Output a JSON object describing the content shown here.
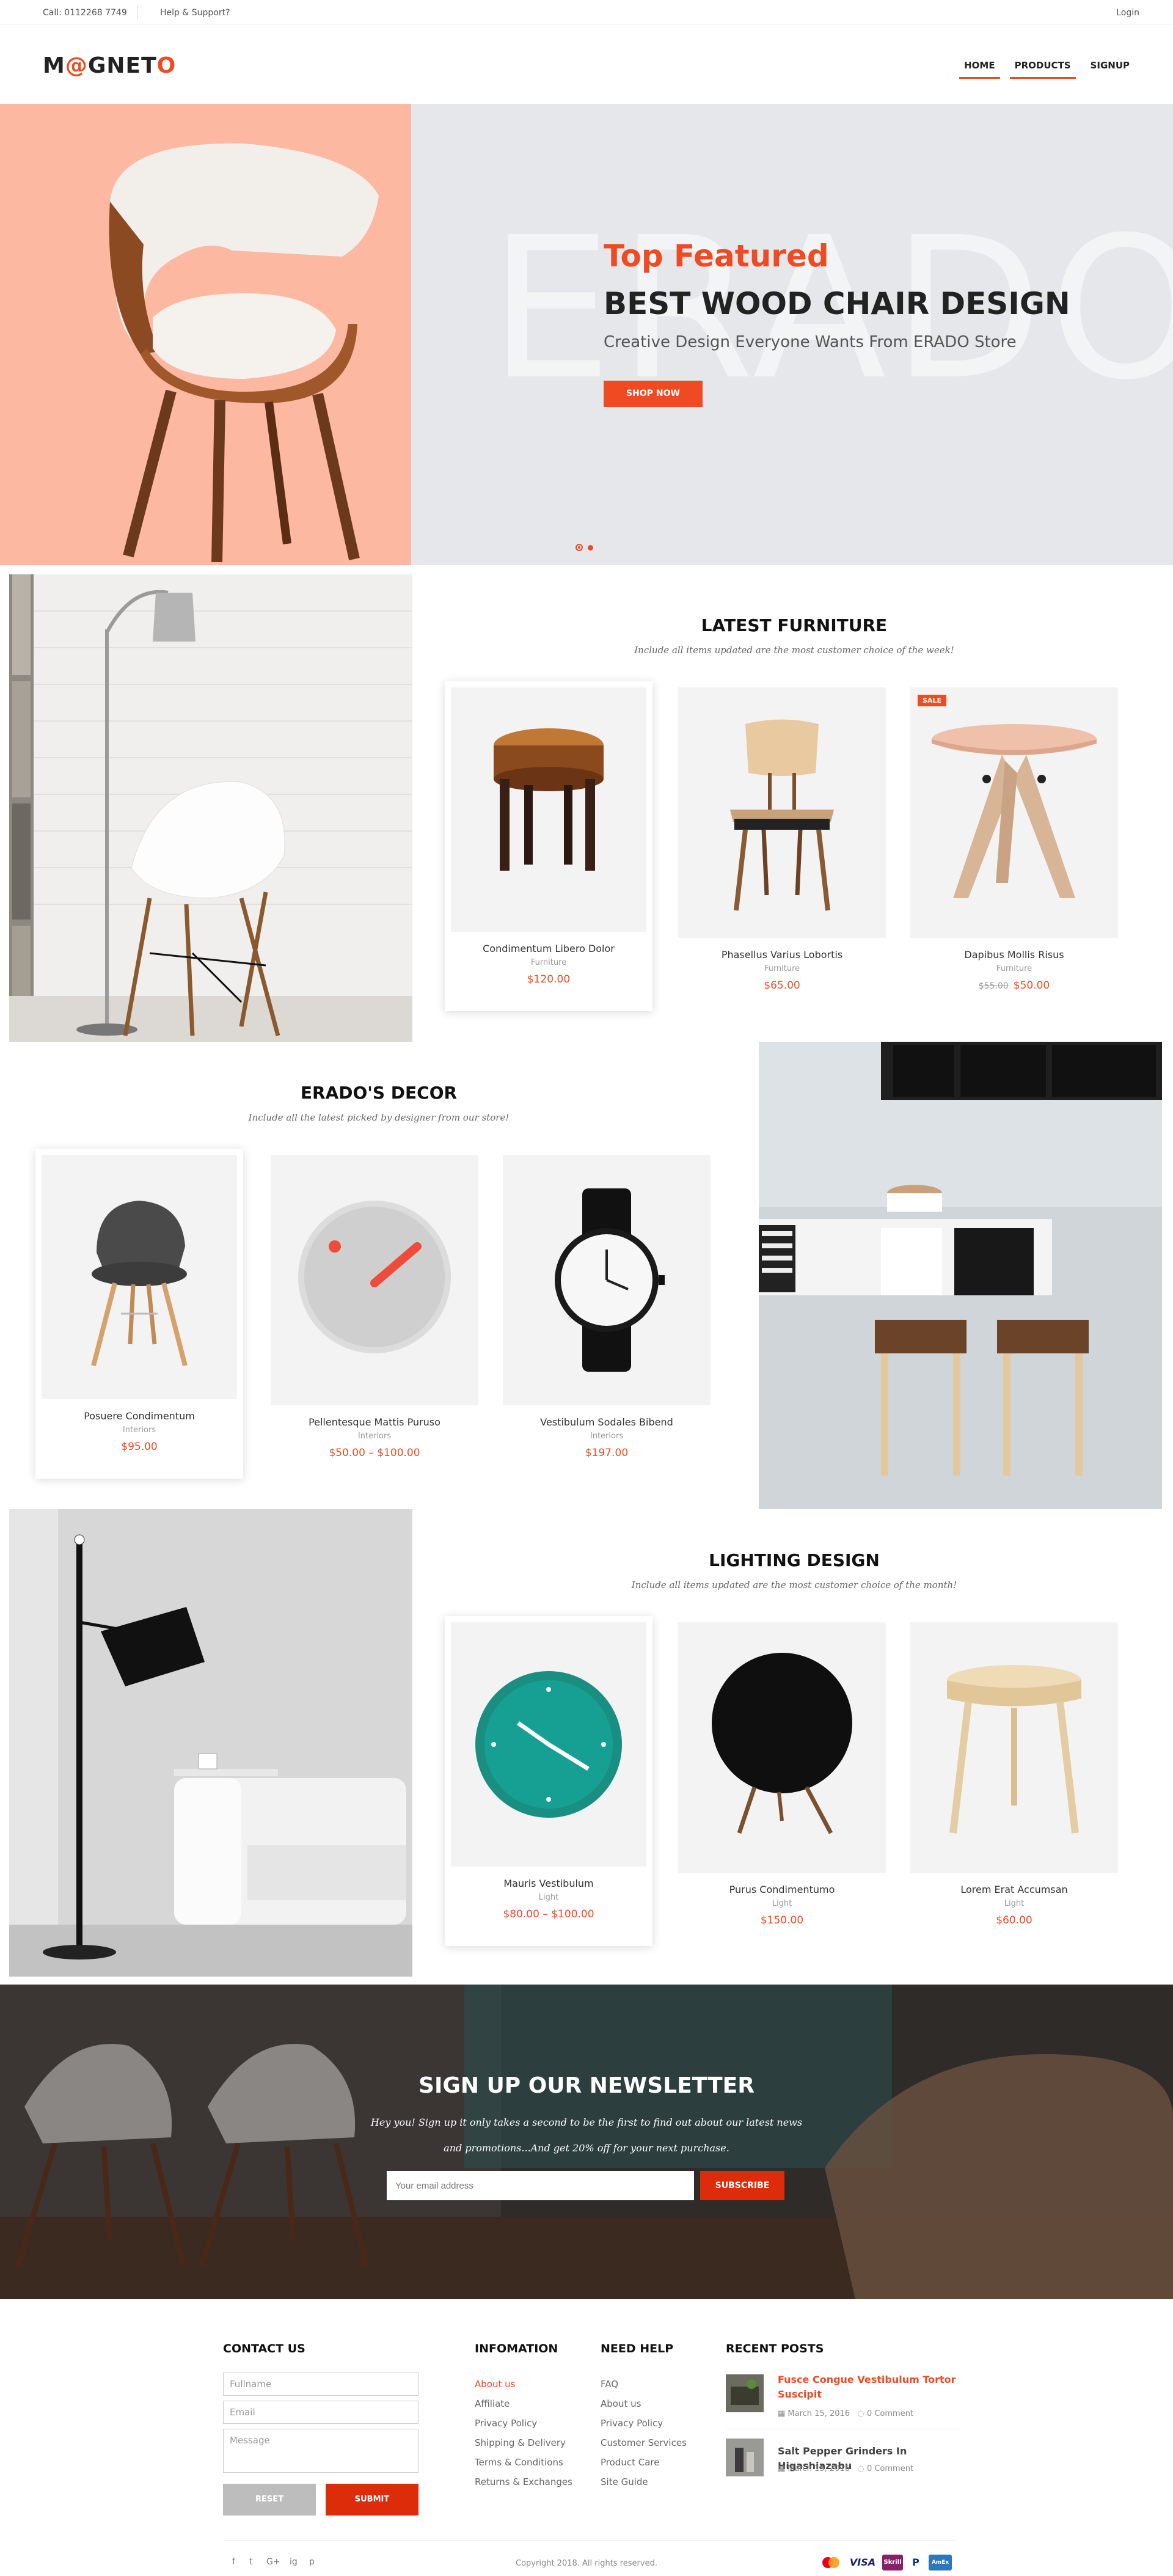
{
  "topbar": {
    "call": "Call: 0112268 7749",
    "help": "Help & Support?",
    "login": "Login"
  },
  "header": {
    "logo_pre": "M",
    "logo_at": "@",
    "logo_mid": "GNET",
    "logo_o": "O",
    "nav": [
      "HOME",
      "PRODUCTS",
      "SIGNUP"
    ]
  },
  "hero": {
    "bigword": "ERADO",
    "top": "Top Featured",
    "title": "BEST WOOD CHAIR DESIGN",
    "subtitle": "Creative Design Everyone Wants From ERADO Store",
    "button": "SHOP NOW"
  },
  "latest": {
    "title": "LATEST FURNITURE",
    "subtitle": "Include all items updated are the most customer choice of the week!",
    "products": [
      {
        "name": "Condimentum Libero Dolor",
        "category": "Furniture",
        "price": "$120.00"
      },
      {
        "name": "Phasellus Varius Lobortis",
        "category": "Furniture",
        "price": "$65.00"
      },
      {
        "name": "Dapibus Mollis Risus",
        "category": "Furniture",
        "old_price": "$55.00",
        "price": "$50.00",
        "badge": "SALE"
      }
    ]
  },
  "decor": {
    "title": "ERADO'S DECOR",
    "subtitle": "Include all the latest picked by designer from our store!",
    "products": [
      {
        "name": "Posuere Condimentum",
        "category": "Interiors",
        "price": "$95.00"
      },
      {
        "name": "Pellentesque Mattis Puruso",
        "category": "Interiors",
        "price": "$50.00 – $100.00"
      },
      {
        "name": "Vestibulum Sodales Bibend",
        "category": "Interiors",
        "price": "$197.00"
      }
    ]
  },
  "lighting": {
    "title": "LIGHTING DESIGN",
    "subtitle": "Include all items updated are the most customer choice of the month!",
    "products": [
      {
        "name": "Mauris Vestibulum",
        "category": "Light",
        "price": "$80.00 – $100.00"
      },
      {
        "name": "Purus Condimentumo",
        "category": "Light",
        "price": "$150.00"
      },
      {
        "name": "Lorem Erat Accumsan",
        "category": "Light",
        "price": "$60.00"
      }
    ]
  },
  "newsletter": {
    "title": "SIGN UP OUR NEWSLETTER",
    "line1": "Hey you! Sign up it only takes a second to be the first to find out about our latest news",
    "line2": "and promotions...And get 20% off for your next purchase.",
    "placeholder": "Your email address",
    "button": "SUBSCRIBE"
  },
  "footer": {
    "contact": {
      "title": "CONTACT US",
      "fullname": "Fullname",
      "email": "Email",
      "message": "Message",
      "reset": "RESET",
      "submit": "SUBMIT"
    },
    "info": {
      "title": "INFOMATION",
      "links": [
        "About us",
        "Affiliate",
        "Privacy Policy",
        "Shipping & Delivery",
        "Terms & Conditions",
        "Returns & Exchanges"
      ]
    },
    "help": {
      "title": "NEED HELP",
      "links": [
        "FAQ",
        "About us",
        "Privacy Policy",
        "Customer Services",
        "Product Care",
        "Site Guide"
      ]
    },
    "posts": {
      "title": "RECENT POSTS",
      "items": [
        {
          "title": "Fusce Congue Vestibulum Tortor Suscipit",
          "date": "March 15, 2016",
          "comments": "0 Comment"
        },
        {
          "title": "Salt Pepper Grinders In Higashiazabu",
          "date": "March 15, 2016",
          "comments": "0 Comment"
        }
      ]
    },
    "copyright": "Copyright 2018. All rights reserved.",
    "social": [
      "f",
      "t",
      "G+",
      "ig",
      "p"
    ],
    "payments": [
      "mastercard",
      "VISA",
      "Skrill",
      "PayPal",
      "AmEx"
    ]
  },
  "colors": {
    "accent": "#ef4b23",
    "hero_pink": "#fdb8a1",
    "hero_gray": "#e5e7ea"
  }
}
